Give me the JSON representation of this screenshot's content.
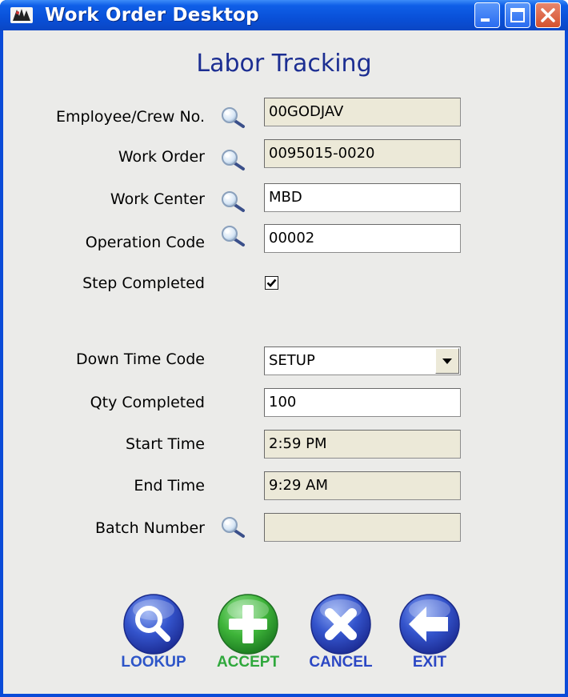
{
  "window": {
    "title": "Work Order Desktop"
  },
  "heading": "Labor Tracking",
  "fields": {
    "employee": {
      "label": "Employee/Crew No.",
      "value": "00GODJAV"
    },
    "work_order": {
      "label": "Work Order",
      "value": "0095015-0020"
    },
    "work_center": {
      "label": "Work Center",
      "value": "MBD"
    },
    "operation_code": {
      "label": "Operation Code",
      "value": "00002"
    },
    "step_completed": {
      "label": "Step Completed",
      "checked": true
    },
    "down_time_code": {
      "label": "Down Time Code",
      "value": "SETUP"
    },
    "qty_completed": {
      "label": "Qty Completed",
      "value": "100"
    },
    "start_time": {
      "label": "Start Time",
      "value": "2:59 PM"
    },
    "end_time": {
      "label": "End Time",
      "value": "9:29 AM"
    },
    "batch_number": {
      "label": "Batch Number",
      "value": ""
    }
  },
  "actions": {
    "lookup": "LOOKUP",
    "accept": "ACCEPT",
    "cancel": "CANCEL",
    "exit": "EXIT"
  },
  "icons": [
    "app-icon",
    "magnifier-icon",
    "minimize-icon",
    "maximize-icon",
    "close-icon",
    "plus-icon",
    "x-icon",
    "back-arrow-icon"
  ],
  "colors": {
    "title_bar": "#0950d8",
    "heading": "#1c2e92",
    "readonly_field": "#ece9d8",
    "lookup": "#2d55c8",
    "accept": "#2fa83c",
    "cancel": "#2b47c4",
    "exit": "#2b47c4"
  }
}
